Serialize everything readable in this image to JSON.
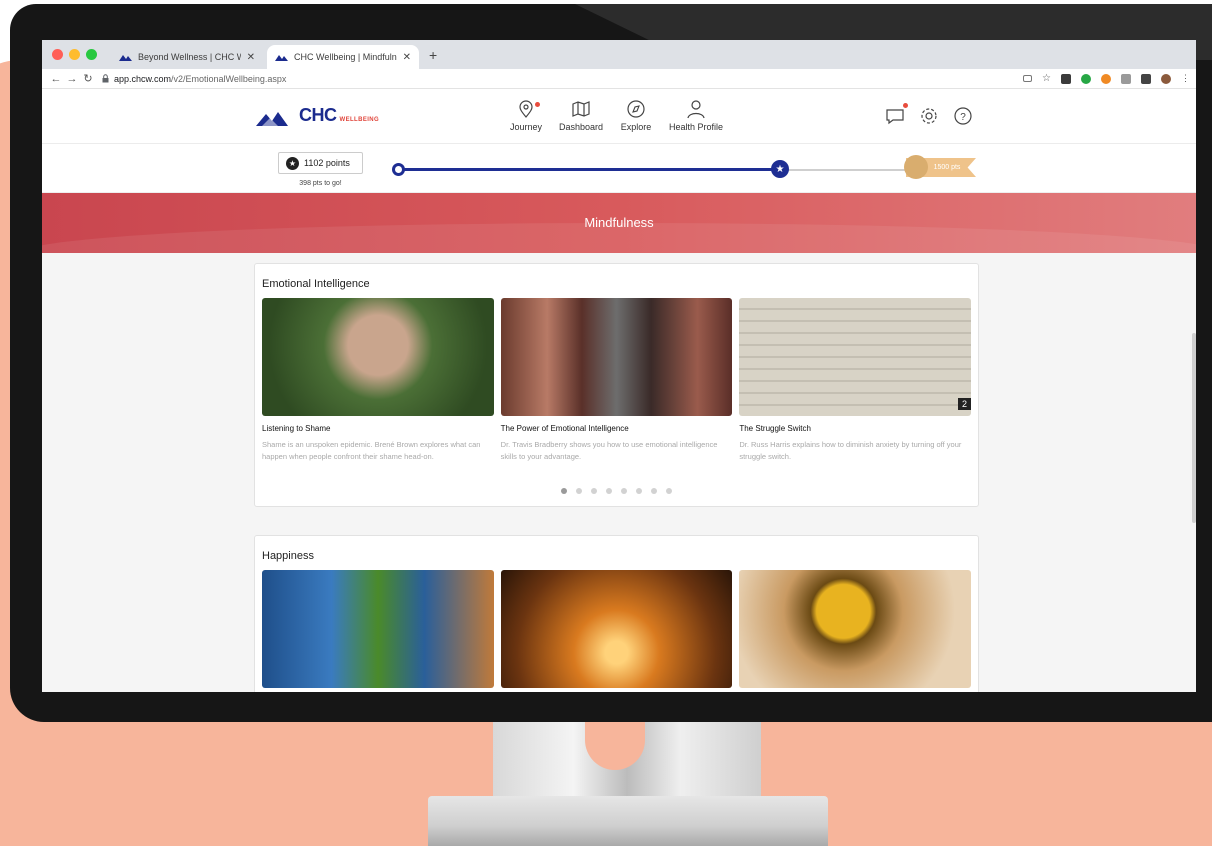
{
  "browser": {
    "tabs": [
      {
        "title": "Beyond Wellness | CHC Wellbe"
      },
      {
        "title": "CHC Wellbeing | Mindfulness"
      }
    ],
    "url_host": "app.chcw.com",
    "url_path": "/v2/EmotionalWellbeing.aspx"
  },
  "header": {
    "logo_text": "CHC",
    "logo_sub": "WELLBEING",
    "nav": [
      {
        "label": "Journey"
      },
      {
        "label": "Dashboard"
      },
      {
        "label": "Explore"
      },
      {
        "label": "Health Profile"
      }
    ]
  },
  "points": {
    "current": "1102 points",
    "to_go": "398 pts to go!",
    "goal": "1500 pts",
    "progress_fraction": 0.73
  },
  "hero": {
    "title": "Mindfulness"
  },
  "sections": [
    {
      "title": "Emotional Intelligence",
      "items": [
        {
          "title": "Listening to Shame",
          "desc": "Shame is an unspoken epidemic. Brené Brown explores what can happen when people confront their shame head-on."
        },
        {
          "title": "The Power of Emotional Intelligence",
          "desc": "Dr. Travis Bradberry shows you how to use emotional intelligence skills to your advantage."
        },
        {
          "title": "The Struggle Switch",
          "desc": "Dr. Russ Harris explains how to diminish anxiety by turning off your struggle switch."
        }
      ],
      "badge": "2"
    },
    {
      "title": "Happiness"
    }
  ]
}
